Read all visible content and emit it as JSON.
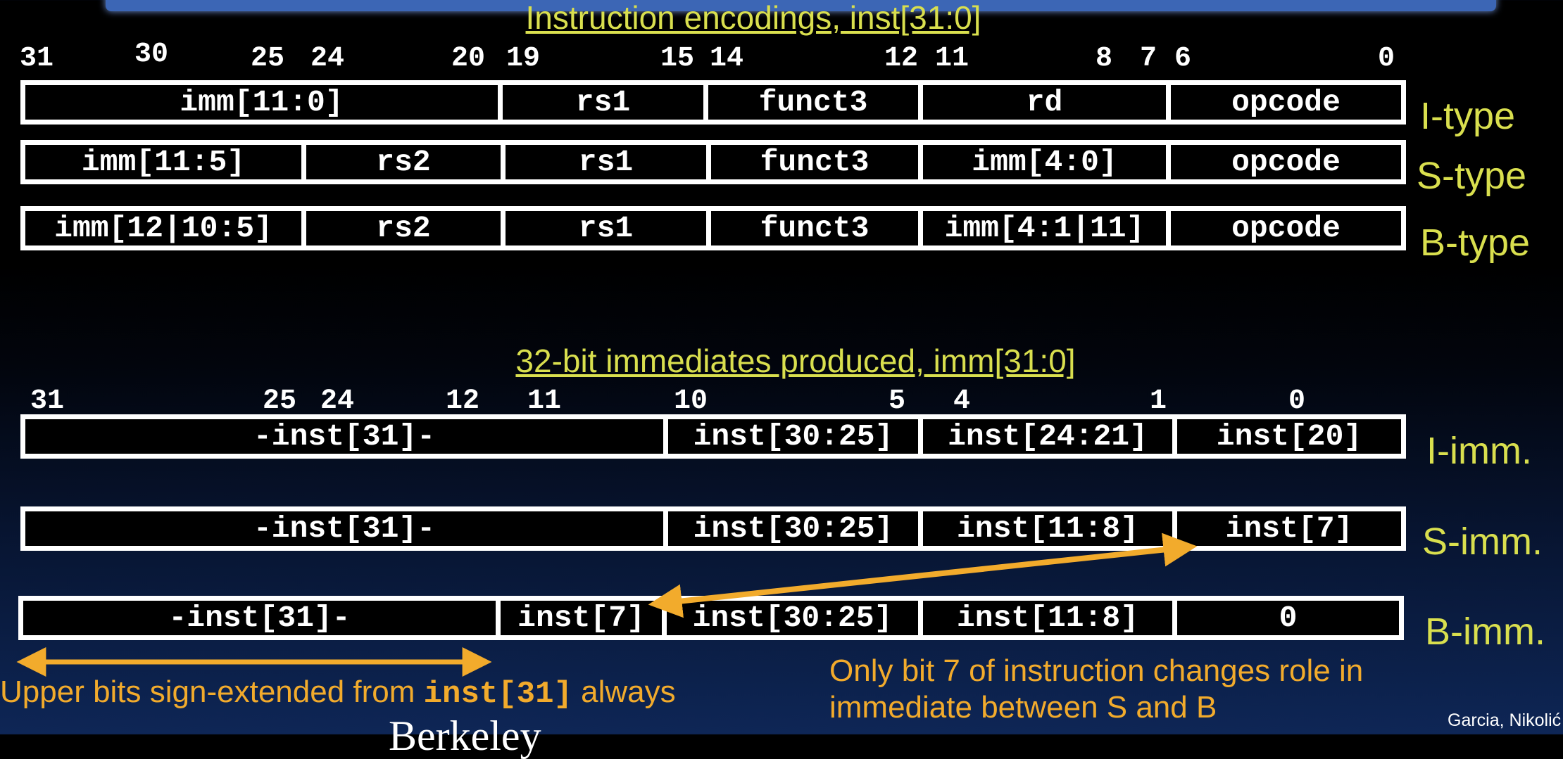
{
  "top_title": "Instruction encodings, inst[31:0]",
  "bottom_title": "32-bit immediates produced, imm[31:0]",
  "encoding_bits": [
    "31",
    "30",
    "25",
    "24",
    "20",
    "19",
    "15",
    "14",
    "12",
    "11",
    "8",
    "7",
    "6",
    "0"
  ],
  "encoding_rows": [
    {
      "label": "I-type",
      "fields": [
        "imm[11:0]",
        "rs1",
        "funct3",
        "rd",
        "opcode"
      ]
    },
    {
      "label": "S-type",
      "fields": [
        "imm[11:5]",
        "rs2",
        "rs1",
        "funct3",
        "imm[4:0]",
        "opcode"
      ]
    },
    {
      "label": "B-type",
      "fields": [
        "imm[12|10:5]",
        "rs2",
        "rs1",
        "funct3",
        "imm[4:1|11]",
        "opcode"
      ]
    }
  ],
  "imm_bits": [
    "31",
    "25",
    "24",
    "12",
    "11",
    "10",
    "5",
    "4",
    "1",
    "0"
  ],
  "imm_rows": [
    {
      "label": "I-imm.",
      "fields": [
        "-inst[31]-",
        "inst[30:25]",
        "inst[24:21]",
        "inst[20]"
      ]
    },
    {
      "label": "S-imm.",
      "fields": [
        "-inst[31]-",
        "inst[30:25]",
        "inst[11:8]",
        "inst[7]"
      ]
    },
    {
      "label": "B-imm.",
      "fields": [
        "-inst[31]-",
        "inst[7]",
        "inst[30:25]",
        "inst[11:8]",
        "0"
      ]
    }
  ],
  "note_left_pre": "Upper bits sign-extended from ",
  "note_left_code": "inst[31]",
  "note_left_post": " always",
  "note_right_line1": "Only bit 7 of instruction changes role in",
  "note_right_line2": "immediate between S and B",
  "credit": "Garcia, Nikolić",
  "cut_word": "Berkeley",
  "colors": {
    "background": "#000000",
    "title": "#d9df4e",
    "arrow": "#f2ab2c",
    "box": "#ffffff",
    "header_bar": "#3c66b5"
  }
}
